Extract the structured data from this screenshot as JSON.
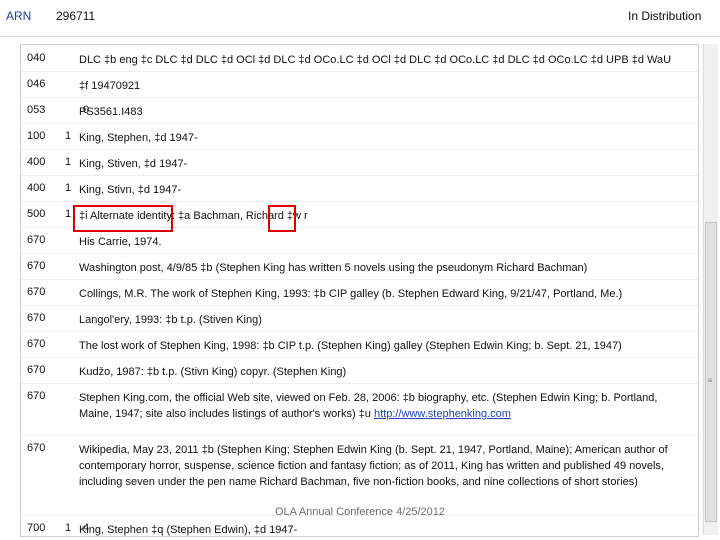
{
  "header": {
    "arn_label": "ARN",
    "arn_value": "296711",
    "status": "In Distribution"
  },
  "fields": [
    {
      "tag": "040",
      "ind1": "",
      "ind2": "",
      "content": "DLC ‡b eng ‡c DLC ‡d DLC ‡d OCl ‡d DLC ‡d OCo.LC ‡d OCl ‡d DLC ‡d OCo.LC ‡d DLC ‡d OCo.LC ‡d UPB ‡d WaU"
    },
    {
      "tag": "046",
      "ind1": "",
      "ind2": "",
      "content": "‡f 19470921"
    },
    {
      "tag": "053",
      "ind1": "",
      "ind2": "0",
      "content": "PS3561.I483"
    },
    {
      "tag": "100",
      "ind1": "1",
      "ind2": "",
      "content": "King, Stephen, ‡d 1947-"
    },
    {
      "tag": "400",
      "ind1": "1",
      "ind2": "",
      "content": "King, Stiven, ‡d 1947-"
    },
    {
      "tag": "400",
      "ind1": "1",
      "ind2": "",
      "content": "King, Stivn, ‡d 1947-"
    },
    {
      "tag": "500",
      "ind1": "1",
      "ind2": "",
      "content": "‡i Alternate identity: ‡a Bachman, Richard ‡w r"
    },
    {
      "tag": "670",
      "ind1": "",
      "ind2": "",
      "content": "His Carrie, 1974."
    },
    {
      "tag": "670",
      "ind1": "",
      "ind2": "",
      "content": "Washington post, 4/9/85 ‡b (Stephen King has written 5 novels using the pseudonym Richard Bachman)"
    },
    {
      "tag": "670",
      "ind1": "",
      "ind2": "",
      "content": "Collings, M.R. The work of Stephen King, 1993: ‡b CIP galley (b. Stephen Edward King, 9/21/47, Portland, Me.)"
    },
    {
      "tag": "670",
      "ind1": "",
      "ind2": "",
      "content": "Langol'ery, 1993: ‡b t.p. (Stiven King)"
    },
    {
      "tag": "670",
      "ind1": "",
      "ind2": "",
      "content": "The lost work of Stephen King, 1998: ‡b CIP t.p. (Stephen King) galley (Stephen Edwin King; b. Sept. 21, 1947)"
    },
    {
      "tag": "670",
      "ind1": "",
      "ind2": "",
      "content": "Kudžo, 1987: ‡b t.p. (Stivn King) copyr. (Stephen King)"
    },
    {
      "tag": "670",
      "ind1": "",
      "ind2": "",
      "content": "Stephen King.com, the official Web site, viewed on Feb. 28, 2006: ‡b biography, etc. (Stephen Edwin King; b. Portland, Maine, 1947; site also includes listings of author's works) ‡u",
      "link": "http://www.stephenking.com"
    },
    {
      "tag": "670",
      "ind1": "",
      "ind2": "",
      "content": "Wikipedia, May 23, 2011 ‡b (Stephen King; Stephen Edwin King (b. Sept. 21, 1947, Portland, Maine); American author of contemporary horror, suspense, science fiction and fantasy fiction; as of 2011, King has written and published 49 novels, including seven under the pen name Richard Bachman, five non-fiction books, and nine collections of short stories)"
    },
    {
      "tag": "700",
      "ind1": "1",
      "ind2": "4",
      "content": "King, Stephen ‡q (Stephen Edwin), ‡d 1947-"
    }
  ],
  "footer": "OLA Annual Conference 4/25/2012",
  "colors": {
    "highlight": "#e00000",
    "link": "#1f3fbf"
  }
}
